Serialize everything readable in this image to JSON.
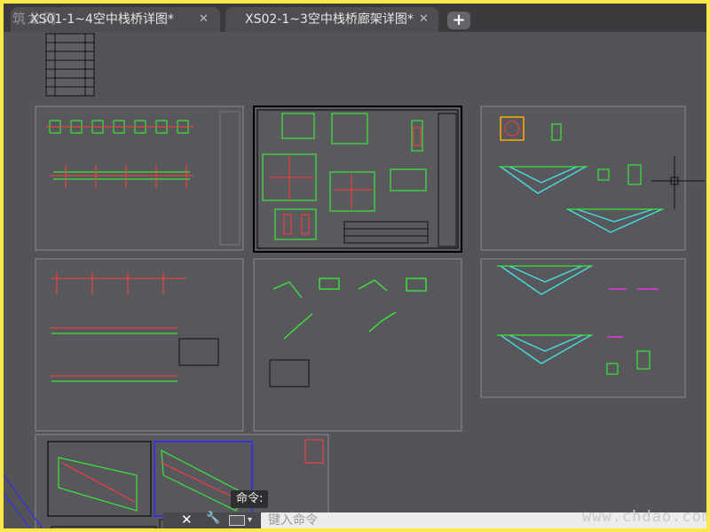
{
  "tabs": [
    {
      "label": "XS01-1~4空中栈桥详图*",
      "close_icon": "close-icon"
    },
    {
      "label": "XS02-1~3空中栈桥廊架详图*",
      "close_icon": "close-icon"
    }
  ],
  "add_tab_icon": "plus-icon",
  "logo_text": "筑龙网",
  "command": {
    "tooltip": "命令:",
    "placeholder": "键入命令",
    "icons": [
      "close-icon",
      "wrench-icon",
      "command-prompt-icon",
      "dropdown-arrow-icon"
    ]
  },
  "watermark": "www.chdao.com",
  "colors": {
    "background": "#545458",
    "tab_active": "#4e4e52",
    "accent_border": "#ffe94a",
    "drawing_green": "#39e639",
    "drawing_red": "#ff3b3b",
    "drawing_cyan": "#44dde0",
    "drawing_magenta": "#ff33ff"
  }
}
